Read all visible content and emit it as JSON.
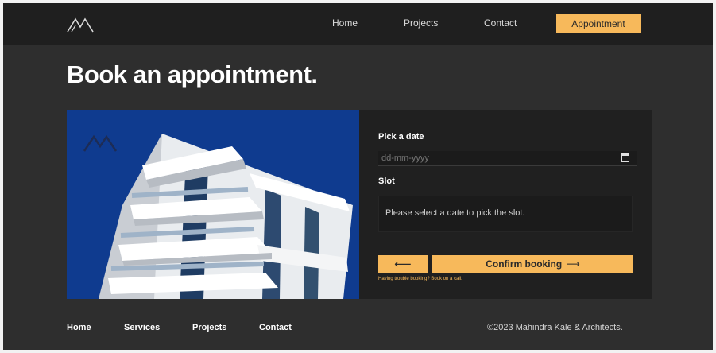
{
  "header": {
    "logo_icon": "mountain-logo-icon",
    "nav": [
      {
        "label": "Home"
      },
      {
        "label": "Projects"
      },
      {
        "label": "Contact"
      }
    ],
    "cta_label": "Appointment"
  },
  "page": {
    "title": "Book an appointment."
  },
  "form": {
    "date_label": "Pick a date",
    "date_placeholder": "dd-mm-yyyy",
    "date_icon": "calendar-icon",
    "slot_label": "Slot",
    "slot_message": "Please select a date to pick the slot.",
    "back_icon": "arrow-left-icon",
    "back_glyph": "⟵",
    "confirm_label": "Confirm booking",
    "confirm_glyph": "⟶",
    "help_text": "Having trouble booking? Book on a call."
  },
  "footer": {
    "links": [
      {
        "label": "Home"
      },
      {
        "label": "Services"
      },
      {
        "label": "Projects"
      },
      {
        "label": "Contact"
      }
    ],
    "copyright": "©2023 Mahindra Kale & Architects."
  },
  "colors": {
    "accent": "#f7b95b",
    "background": "#2e2e2e",
    "header": "#1f1f1f",
    "panel": "#202020",
    "sky": "#0f3b8f"
  }
}
